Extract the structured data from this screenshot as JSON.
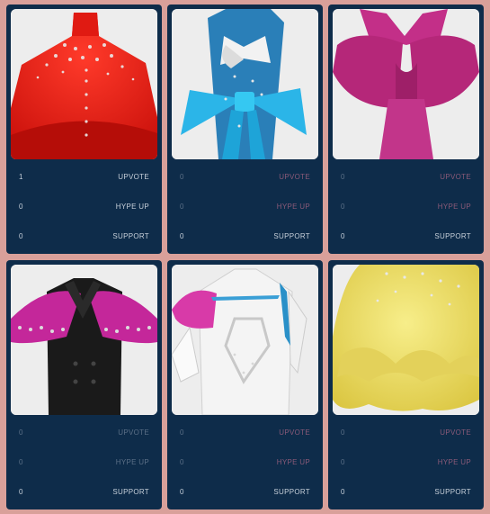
{
  "cards": [
    {
      "garment": "red-jeweled-cape",
      "actions": [
        {
          "count": "1",
          "label": "UPVOTE",
          "active": true
        },
        {
          "count": "0",
          "label": "HYPE UP",
          "active": true
        },
        {
          "count": "0",
          "label": "SUPPORT",
          "active": true
        }
      ]
    },
    {
      "garment": "blue-bow-coat",
      "actions": [
        {
          "count": "0",
          "label": "UPVOTE",
          "active": false
        },
        {
          "count": "0",
          "label": "HYPE UP",
          "active": false
        },
        {
          "count": "0",
          "label": "SUPPORT",
          "active": true
        }
      ]
    },
    {
      "garment": "magenta-bow-dress",
      "actions": [
        {
          "count": "0",
          "label": "UPVOTE",
          "active": false
        },
        {
          "count": "0",
          "label": "HYPE UP",
          "active": false
        },
        {
          "count": "0",
          "label": "SUPPORT",
          "active": true
        }
      ]
    },
    {
      "garment": "black-magenta-jacket",
      "actions": [
        {
          "count": "0",
          "label": "UPVOTE",
          "active": false
        },
        {
          "count": "0",
          "label": "HYPE UP",
          "active": false
        },
        {
          "count": "0",
          "label": "SUPPORT",
          "active": true
        }
      ]
    },
    {
      "garment": "white-trench-coat",
      "actions": [
        {
          "count": "0",
          "label": "UPVOTE",
          "active": false
        },
        {
          "count": "0",
          "label": "HYPE UP",
          "active": false
        },
        {
          "count": "0",
          "label": "SUPPORT",
          "active": true
        }
      ]
    },
    {
      "garment": "yellow-ruffle-dress",
      "actions": [
        {
          "count": "0",
          "label": "UPVOTE",
          "active": false
        },
        {
          "count": "0",
          "label": "HYPE UP",
          "active": false
        },
        {
          "count": "0",
          "label": "SUPPORT",
          "active": true
        }
      ]
    }
  ],
  "colors": {
    "page_bg": "#d9a09a",
    "card_bg": "#0e2c4a",
    "active_text": "#c6cfd9",
    "dim_text": "#5b6f86",
    "dim_pink_text": "#8a5a78"
  }
}
